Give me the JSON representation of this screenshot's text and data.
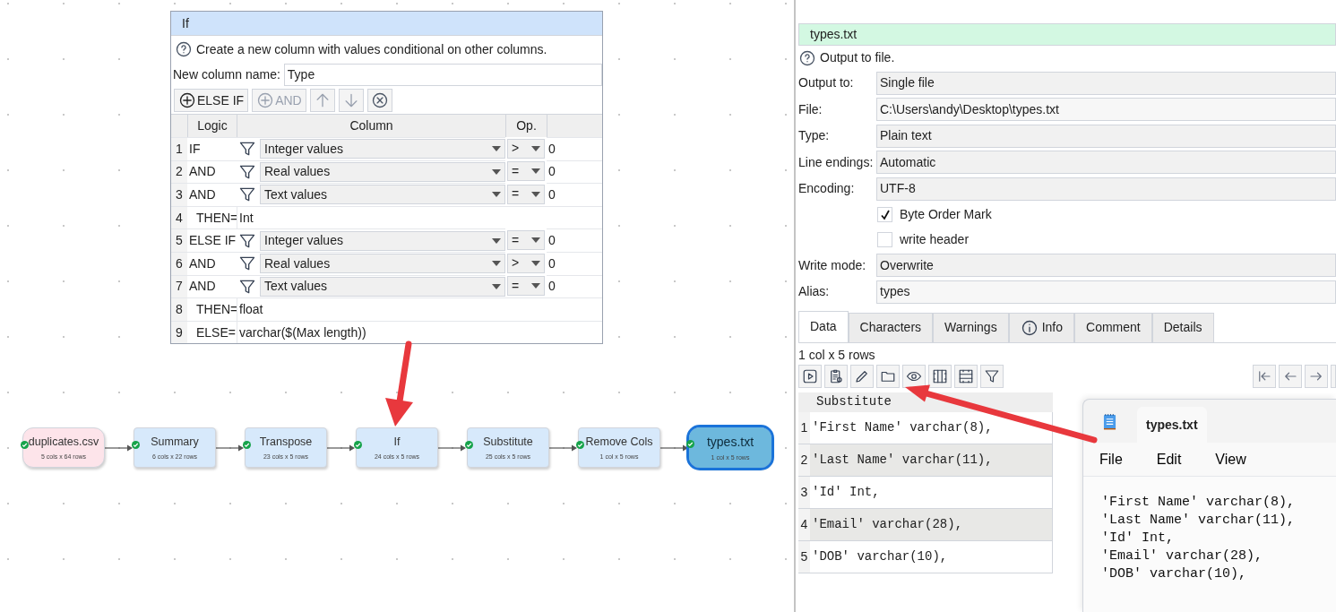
{
  "if_panel": {
    "title": "If",
    "description": "Create a new column with values conditional on other columns.",
    "new_column_label": "New column name:",
    "new_column_value": "Type",
    "toolbar": [
      {
        "kind": "add",
        "label": "ELSE IF",
        "disabled": false
      },
      {
        "kind": "add",
        "label": "AND",
        "disabled": true
      },
      {
        "kind": "up"
      },
      {
        "kind": "down"
      },
      {
        "kind": "remove"
      }
    ],
    "columns": [
      "Logic",
      "Column",
      "Op."
    ],
    "rows": [
      {
        "kind": "condition",
        "number": "1",
        "logic": "IF",
        "column": "Integer values",
        "op": ">",
        "value": "0"
      },
      {
        "kind": "condition",
        "number": "2",
        "logic": "AND",
        "column": "Real values",
        "op": "=",
        "value": "0"
      },
      {
        "kind": "condition",
        "number": "3",
        "logic": "AND",
        "column": "Text values",
        "op": "=",
        "value": "0"
      },
      {
        "kind": "result",
        "number": "4",
        "logic": "THEN=",
        "value": "Int"
      },
      {
        "kind": "condition",
        "number": "5",
        "logic": "ELSE IF",
        "column": "Integer values",
        "op": "=",
        "value": "0"
      },
      {
        "kind": "condition",
        "number": "6",
        "logic": "AND",
        "column": "Real values",
        "op": ">",
        "value": "0"
      },
      {
        "kind": "condition",
        "number": "7",
        "logic": "AND",
        "column": "Text values",
        "op": "=",
        "value": "0"
      },
      {
        "kind": "result",
        "number": "8",
        "logic": "THEN=",
        "value": "float"
      },
      {
        "kind": "result",
        "number": "9",
        "logic": "ELSE=",
        "value": "varchar($(Max length))"
      }
    ]
  },
  "flow": {
    "nodes": [
      {
        "kind": "input",
        "name": "duplicates.csv",
        "size": "5 cols x 64 rows",
        "selected": false
      },
      {
        "kind": "transform",
        "name": "Summary",
        "size": "6 cols x 22 rows",
        "selected": false
      },
      {
        "kind": "transform",
        "name": "Transpose",
        "size": "23 cols x 5 rows",
        "selected": false
      },
      {
        "kind": "transform",
        "name": "If",
        "size": "24 cols x 5 rows",
        "selected": false
      },
      {
        "kind": "transform",
        "name": "Substitute",
        "size": "25 cols x 5 rows",
        "selected": false
      },
      {
        "kind": "transform",
        "name": "Remove Cols",
        "size": "1 col x 5 rows",
        "selected": false
      },
      {
        "kind": "output",
        "name": "types.txt",
        "size": "1 col x 5 rows",
        "selected": true
      }
    ]
  },
  "output_panel": {
    "title": "types.txt",
    "description": "Output to file.",
    "fields": [
      {
        "kind": "select",
        "label": "Output to:",
        "value": "Single file"
      },
      {
        "kind": "text",
        "label": "File:",
        "value": "C:\\Users\\andy\\Desktop\\types.txt"
      },
      {
        "kind": "select",
        "label": "Type:",
        "value": "Plain text"
      },
      {
        "kind": "select",
        "label": "Line endings:",
        "value": "Automatic"
      },
      {
        "kind": "select",
        "label": "Encoding:",
        "value": "UTF-8"
      },
      {
        "kind": "checkbox",
        "value": "Byte Order Mark",
        "checked": true
      },
      {
        "kind": "checkbox",
        "value": "write header",
        "checked": false
      },
      {
        "kind": "select",
        "label": "Write mode:",
        "value": "Overwrite"
      },
      {
        "kind": "text",
        "label": "Alias:",
        "value": "types"
      }
    ],
    "tabs": [
      {
        "kind": "plain",
        "label": "Data",
        "selected": true
      },
      {
        "kind": "plain",
        "label": "Characters",
        "selected": false
      },
      {
        "kind": "plain",
        "label": "Warnings",
        "selected": false
      },
      {
        "kind": "info",
        "label": "Info",
        "selected": false
      },
      {
        "kind": "plain",
        "label": "Comment",
        "selected": false
      },
      {
        "kind": "plain",
        "label": "Details",
        "selected": false
      }
    ],
    "summary": "1 col x 5 rows",
    "data_column": "Substitute",
    "data_rows": [
      {
        "number": "1",
        "value": "'First Name' varchar(8),"
      },
      {
        "number": "2",
        "value": "'Last Name' varchar(11),"
      },
      {
        "number": "3",
        "value": "'Id' Int,"
      },
      {
        "number": "4",
        "value": "'Email' varchar(28),"
      },
      {
        "number": "5",
        "value": "'DOB' varchar(10),"
      }
    ]
  },
  "notepad": {
    "title": "types.txt",
    "menu": [
      "File",
      "Edit",
      "View"
    ],
    "lines": [
      "'First Name' varchar(8),",
      "'Last Name' varchar(11),",
      "'Id' Int,",
      "'Email' varchar(28),",
      "'DOB' varchar(10),"
    ]
  }
}
